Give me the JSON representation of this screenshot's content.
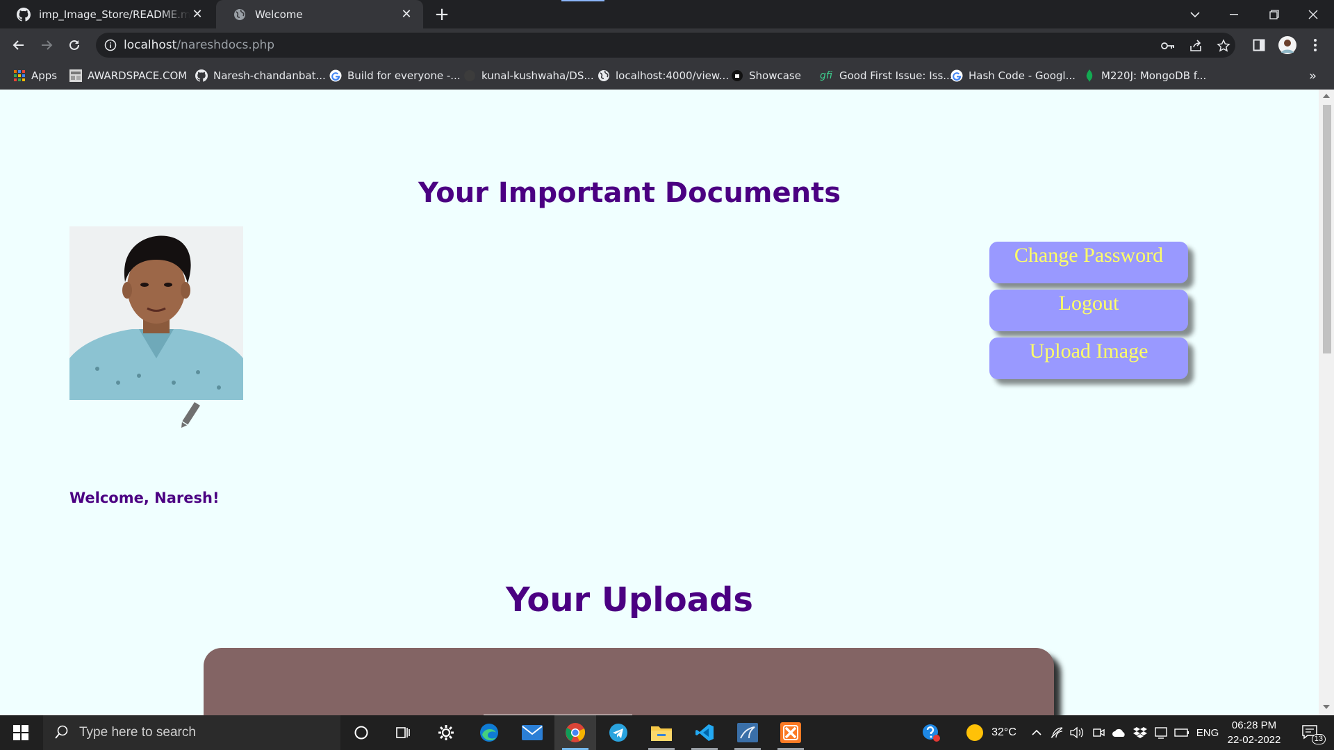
{
  "browser": {
    "tabs": [
      {
        "title": "imp_Image_Store/README.md at",
        "close": "✕"
      },
      {
        "title": "Welcome",
        "close": "✕"
      }
    ],
    "new_tab": "+",
    "url_host": "localhost",
    "url_path": "/nareshdocs.php",
    "bookmarks": [
      {
        "label": "Apps",
        "icon": "apps-grid-icon"
      },
      {
        "label": "AWARDSPACE.COM",
        "icon": "site-icon"
      },
      {
        "label": "Naresh-chandanbat...",
        "icon": "github-icon"
      },
      {
        "label": "Build for everyone -...",
        "icon": "google-icon"
      },
      {
        "label": "kunal-kushwaha/DS...",
        "icon": "github-icon"
      },
      {
        "label": "localhost:4000/view...",
        "icon": "globe-icon"
      },
      {
        "label": "Showcase",
        "icon": "showcase-icon"
      },
      {
        "label": "Good First Issue: Iss...",
        "icon": "gfi-icon"
      },
      {
        "label": "Hash Code - Googl...",
        "icon": "google-icon"
      },
      {
        "label": "M220J: MongoDB f...",
        "icon": "mongodb-leaf-icon"
      }
    ],
    "bookmarks_overflow": "»",
    "gfi_mark": "gfi"
  },
  "page": {
    "heading": "Your Important Documents",
    "welcome": "Welcome, Naresh!",
    "buttons": {
      "change_password": "Change Password",
      "logout": "Logout",
      "upload_image": "Upload Image"
    },
    "uploads_heading": "Your Uploads"
  },
  "taskbar": {
    "search_placeholder": "Type here to search",
    "weather_temp": "32°C",
    "language": "ENG",
    "time": "06:28 PM",
    "date": "22-02-2022",
    "notifications_count": "13"
  },
  "colors": {
    "page_bg": "#f0ffff",
    "heading": "#4b0082",
    "button_bg": "#9999ff",
    "button_text": "#ffff66",
    "uploads_panel": "#836464"
  }
}
